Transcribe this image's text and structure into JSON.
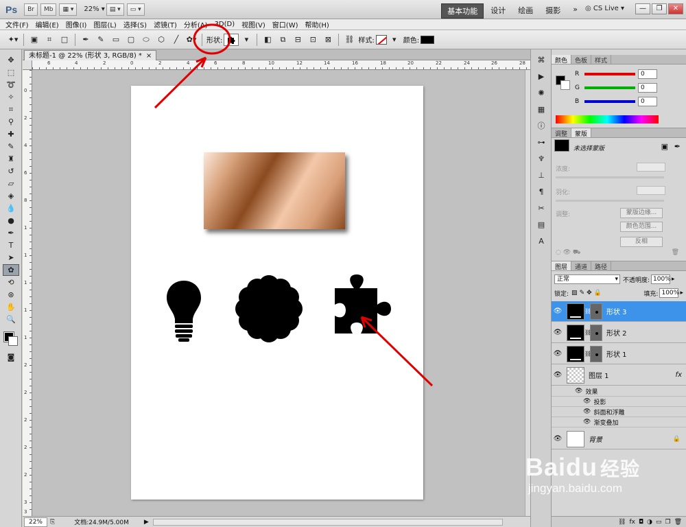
{
  "app": {
    "logo": "Ps",
    "zoom": "22%",
    "title_buttons": [
      "Br",
      "Mb"
    ],
    "workspaces": [
      "基本功能",
      "设计",
      "绘画",
      "摄影"
    ],
    "workspace_more": "»",
    "cslive": "CS Live",
    "window_controls": [
      "—",
      "❐",
      "✕"
    ]
  },
  "menu": [
    "文件(F)",
    "编辑(E)",
    "图像(I)",
    "图层(L)",
    "选择(S)",
    "滤镜(T)",
    "分析(A)",
    "3D(D)",
    "视图(V)",
    "窗口(W)",
    "帮助(H)"
  ],
  "options": {
    "shape_label": "形状:",
    "style_label": "样式:",
    "color_label": "颜色:",
    "color_hex": "#000000"
  },
  "document": {
    "tab_title": "未标题-1 @ 22% (形状 3, RGB/8) *",
    "tab_close": "×",
    "ruler_top": [
      "6",
      "4",
      "2",
      "0",
      "2",
      "4",
      "6",
      "8",
      "10",
      "12",
      "14",
      "16",
      "18",
      "20",
      "22",
      "24",
      "26",
      "28"
    ],
    "ruler_left": [
      "0",
      "2",
      "4",
      "6",
      "8",
      "1",
      "1",
      "1",
      "1",
      "1",
      "2",
      "2",
      "2",
      "2",
      "2",
      "3",
      "3"
    ],
    "status_zoom": "22%",
    "status_doc": "文档:24.9M/5.00M"
  },
  "color_panel": {
    "tabs": [
      "颜色",
      "色板",
      "样式"
    ],
    "r_label": "R",
    "g_label": "G",
    "b_label": "B",
    "r": "0",
    "g": "0",
    "b": "0",
    "r_color": "#e00000",
    "g_color": "#00b000",
    "b_color": "#0000d0"
  },
  "adjust_panel": {
    "tabs": [
      "调整",
      "蒙版"
    ],
    "mask_label": "未选择蒙版",
    "density": "浓度:",
    "feather": "羽化:",
    "refine": "调整:",
    "btn_edge": "蒙版边缘...",
    "btn_range": "颜色范围...",
    "btn_invert": "反相"
  },
  "layers_panel": {
    "tabs": [
      "图层",
      "通道",
      "路径"
    ],
    "blend_mode": "正常",
    "opacity_label": "不透明度:",
    "opacity": "100%",
    "lock_label": "锁定:",
    "fill_label": "填充:",
    "fill": "100%",
    "layers": [
      {
        "name": "形状 3",
        "selected": true
      },
      {
        "name": "形状 2",
        "selected": false
      },
      {
        "name": "形状 1",
        "selected": false
      },
      {
        "name": "图层 1",
        "fx": "fx"
      },
      {
        "name": "背景",
        "locked": true
      }
    ],
    "effects_label": "效果",
    "effects": [
      "投影",
      "斜面和浮雕",
      "渐变叠加"
    ]
  },
  "watermark": {
    "brand": "Baidu",
    "brand_cn": "经验",
    "url": "jingyan.baidu.com"
  },
  "accent_colors": {
    "selection_blue": "#3d92ea",
    "annotation_red": "#e00000"
  }
}
